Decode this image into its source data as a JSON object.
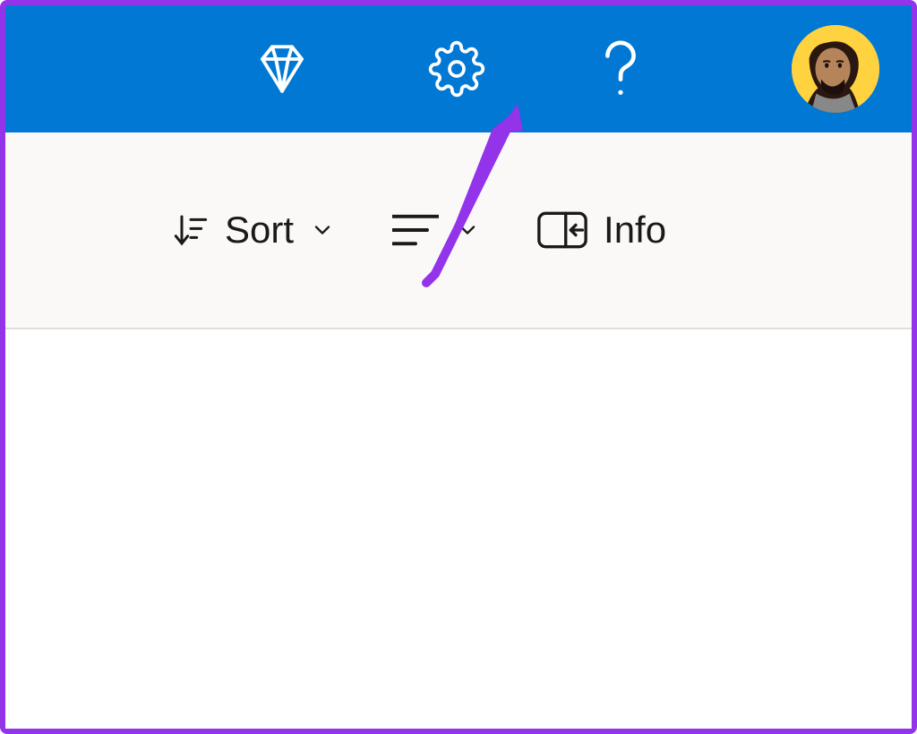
{
  "colors": {
    "brand": "#0078d4",
    "annotation": "#9333ea",
    "avatar_bg": "#ffd23f"
  },
  "header": {
    "premium_icon": "diamond-icon",
    "settings_icon": "gear-icon",
    "help_icon": "question-icon",
    "avatar_icon": "avatar"
  },
  "toolbar": {
    "sort_label": "Sort",
    "info_label": "Info"
  },
  "annotation": {
    "type": "arrow",
    "target": "settings-icon"
  }
}
